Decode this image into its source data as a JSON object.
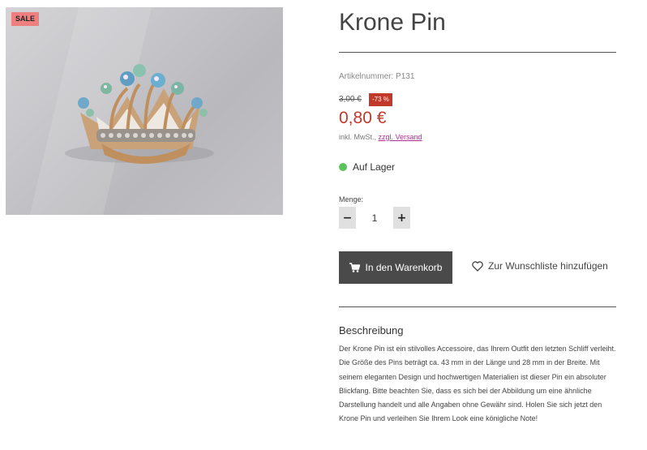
{
  "product": {
    "title": "Krone Pin",
    "sale_badge": "SALE",
    "sku_label": "Artikelnummer:",
    "sku_value": "P131",
    "old_price": "3,00 €",
    "discount": "-73 %",
    "price": "0,80 €",
    "tax_prefix": "inkl. MwSt.,",
    "shipping_link": "zzgl. Versand",
    "stock_status": "Auf Lager"
  },
  "quantity": {
    "label": "Menge:",
    "value": "1",
    "minus": "−",
    "plus": "+"
  },
  "actions": {
    "cart_label": "In den Warenkorb",
    "wishlist_label": "Zur Wunschliste hinzufügen"
  },
  "description": {
    "heading": "Beschreibung",
    "text": "Der Krone Pin ist ein stilvolles Accessoire, das Ihrem Outfit den letzten Schliff verleiht. Die Größe des Pins beträgt ca. 43 mm in der Länge und 28 mm in der Breite. Mit seinem eleganten Design und hochwertigen Materialien ist dieser Pin ein absoluter Blickfang. Bitte beachten Sie, dass es sich bei der Abbildung um eine ähnliche Darstellung handelt und alle Angaben ohne Gewähr sind. Holen Sie sich jetzt den Krone Pin und verleihen Sie Ihrem Look eine königliche Note!"
  },
  "colors": {
    "sale_badge": "#f08080",
    "price_red": "#c0392b",
    "stock_green": "#5cc35c",
    "cart_button": "#4a4a4a",
    "link_magenta": "#b03090"
  },
  "icons": {
    "cart": "cart-icon",
    "wishlist": "heart-icon",
    "stock": "stock-dot-icon"
  }
}
